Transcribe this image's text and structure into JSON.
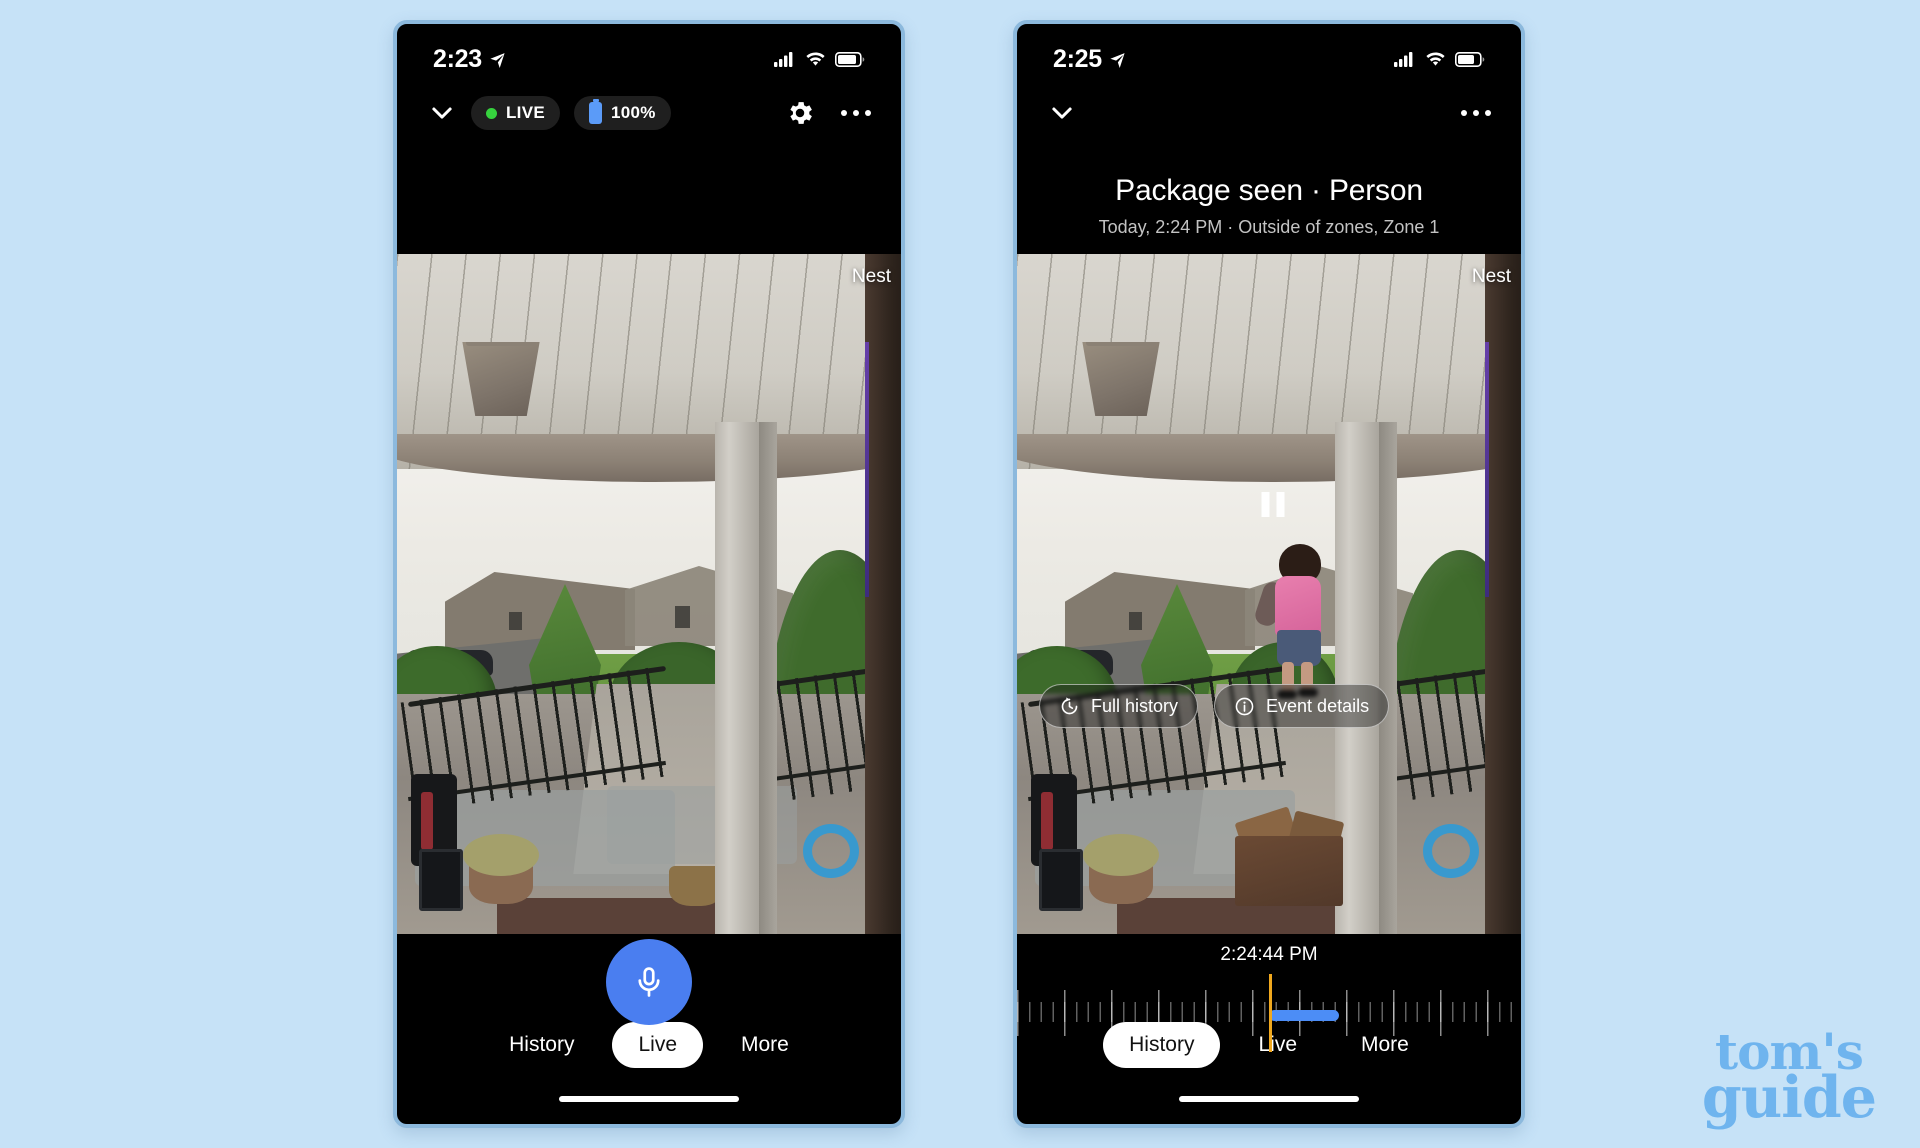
{
  "page": {
    "background_color": "#c6e2f7",
    "watermark": {
      "line1": "tom's",
      "line2": "guide",
      "color": "#6fb4ee"
    }
  },
  "phones": [
    {
      "id": "live-view",
      "status_bar": {
        "time": "2:23",
        "location_icon": "location-arrow-icon",
        "signal_icon": "cellular-signal-icon",
        "wifi_icon": "wifi-icon",
        "battery_icon": "battery-icon"
      },
      "app_bar": {
        "collapse_icon": "chevron-down-icon",
        "live_badge": {
          "label": "LIVE",
          "dot_color": "#36d23e"
        },
        "battery_badge": {
          "label": "100%",
          "icon": "battery-icon",
          "color": "#5b9bf8"
        },
        "settings_icon": "gear-icon",
        "overflow_icon": "more-horizontal-icon"
      },
      "video": {
        "watermark": "Nest"
      },
      "talk_button": {
        "icon": "microphone-icon",
        "color": "#4a7ef0"
      },
      "bottom_nav": {
        "tabs": [
          {
            "label": "History",
            "active": false
          },
          {
            "label": "Live",
            "active": true
          },
          {
            "label": "More",
            "active": false
          }
        ]
      }
    },
    {
      "id": "event-history-view",
      "status_bar": {
        "time": "2:25",
        "location_icon": "location-arrow-icon",
        "signal_icon": "cellular-signal-icon",
        "wifi_icon": "wifi-icon",
        "battery_icon": "battery-icon"
      },
      "app_bar": {
        "collapse_icon": "chevron-down-icon",
        "overflow_icon": "more-horizontal-icon"
      },
      "event": {
        "title": "Package seen · Person",
        "subtitle": "Today, 2:24 PM · Outside of zones, Zone 1"
      },
      "video": {
        "watermark": "Nest",
        "playback_icon": "pause-icon"
      },
      "actions": [
        {
          "label": "Full history",
          "icon": "history-clock-icon"
        },
        {
          "label": "Event details",
          "icon": "info-circle-icon"
        }
      ],
      "timeline": {
        "current_time": "2:24:44 PM",
        "playhead_color": "#f0a81e",
        "event_marker_color": "#4c8df6"
      },
      "bottom_nav": {
        "tabs": [
          {
            "label": "History",
            "active": true
          },
          {
            "label": "Live",
            "active": false
          },
          {
            "label": "More",
            "active": false
          }
        ]
      }
    }
  ]
}
